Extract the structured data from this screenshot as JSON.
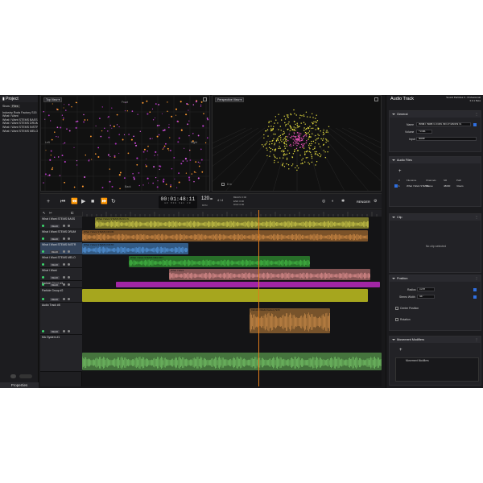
{
  "left_panel": {
    "title": "Project",
    "show_label": "Show",
    "files_button": "Files",
    "files": [
      "Industry Rods Factory S15",
      "What I Want",
      "What I Want STEMS BASS",
      "What I Want STEMS DRUMS",
      "What I Want STEMS INSTR",
      "What I Want STEMS MELO"
    ],
    "properties_tab": "Properties"
  },
  "views": {
    "top": {
      "label": "Top View",
      "sub": [
        "Left",
        "Right",
        "Back",
        "Front"
      ]
    },
    "persp": {
      "label": "Perspective View",
      "axis": "X m",
      "dim": "8 m"
    }
  },
  "transport": {
    "timecode": "00:01:48:11",
    "tc_units": "HR   MIN   SEC   FR",
    "tempo": "120",
    "tempo_sub": ".00",
    "bpm_label": "BPM",
    "sig": "4 / 4",
    "begin_label": "BEGIN",
    "end_label": "END",
    "dur_label": "DUR",
    "render_label": "RENDER",
    "loop": "0:00"
  },
  "tracks": [
    {
      "name": "What I Want STEMS BASS",
      "read": "READ"
    },
    {
      "name": "What I Want STEMS DRUM",
      "read": "READ"
    },
    {
      "name": "What I Want STEMS INSTR",
      "read": "READ"
    },
    {
      "name": "What I Want STEMS MELO",
      "read": "READ"
    },
    {
      "name": "What I Want",
      "read": "READ"
    },
    {
      "name": "Particle Group #1",
      "read": "READ"
    },
    {
      "name": "Particle Group #2",
      "read": "READ"
    },
    {
      "name": "Audio Track #8",
      "read": "READ"
    },
    {
      "name": "Mic System #1",
      "read": ""
    }
  ],
  "clips": [
    {
      "label": "What I Want STEMS BASS W",
      "color": "#dcd84e"
    },
    {
      "label": "What I Want STEMS DRUM",
      "color": "#e0954a"
    },
    {
      "label": "What I Want STEMS INSTR",
      "color": "#5aa3f0"
    },
    {
      "label": "What I Want STEMS MELODY",
      "color": "#49c94a"
    },
    {
      "label": "What I Want",
      "color": "#f19a9a"
    },
    {
      "label": "",
      "color": "#a126a5"
    },
    {
      "label": "",
      "color": "#a6a61e"
    },
    {
      "label": "Industry Rods Factory S15",
      "color": "#d9964e"
    },
    {
      "label": "",
      "color": "#7ed36e"
    }
  ],
  "inspector": {
    "title": "Audio Track",
    "app_name": "Sound Particles 3 - Professional",
    "app_version": "3.0.1 Beta",
    "general": {
      "header": "General",
      "name_label": "Name",
      "name_value": "What I Want STEMS INSTRUMENTS",
      "volume_label": "Volume",
      "volume_value": "+0 dB",
      "input_label": "Input",
      "input_value": "None"
    },
    "audio_files": {
      "header": "Audio Files",
      "cols": [
        "#",
        "Filename",
        "Channels",
        "SR",
        "Path"
      ],
      "row": [
        "1",
        "What I Want STEMS",
        "Stereo",
        "48000",
        "/Users"
      ]
    },
    "clip": {
      "header": "Clip",
      "empty": "No clip selected"
    },
    "position": {
      "header": "Position",
      "radius_label": "Radius",
      "radius_value": "10 m",
      "stereo_label": "Stereo Width",
      "stereo_value": "45 °",
      "center_label": "Center Position",
      "rotation_label": "Rotation"
    },
    "movement": {
      "header": "Movement Modifiers",
      "col": "Movement Modifiers"
    }
  },
  "accent": "#e07b1b"
}
